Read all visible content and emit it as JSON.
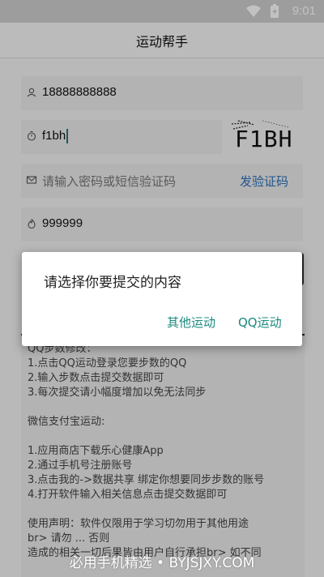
{
  "status_bar": {
    "time": "9:01",
    "icons": [
      "wifi-icon",
      "battery-charging-icon"
    ]
  },
  "app_bar": {
    "title": "运动帮手"
  },
  "form": {
    "phone": {
      "value": "18888888888",
      "icon": "user-icon"
    },
    "captcha": {
      "value": "f1bh",
      "image_text": "F1BH",
      "icon": "timer-icon"
    },
    "password": {
      "placeholder": "请输入密码或短信验证码",
      "icon": "mail-icon",
      "sms_link": "发验证码"
    },
    "steps": {
      "value": "999999",
      "icon": "flame-icon"
    }
  },
  "info": {
    "lines": [
      "QQ步数修改：",
      "1.点击QQ运动登录您要步数的QQ",
      "2.输入步数点击提交数据即可",
      "3.每次提交请小幅度增加以免无法同步",
      "",
      "微信支付宝运动:",
      "",
      "1.应用商店下载乐心健康App",
      "2.通过手机号注册账号",
      "3.点击我的->数据共享 绑定你想要同步步数的账号",
      "4.打开软件输入相关信息点击提交数据即可",
      "",
      "使用声明：软件仅限用于学习切勿用于其他用途",
      "br> 请勿 ... 否则",
      "造成的相关一切后果皆由用户自行承担br> 如不同"
    ]
  },
  "dialog": {
    "title": "请选择你要提交的内容",
    "buttons": {
      "other": "其他运动",
      "qq": "QQ运动"
    }
  },
  "watermark": "必用手机精选 • BYJSJXY.COM",
  "colors": {
    "accent": "#1a8a7e",
    "link": "#2d72b8",
    "scrim": "rgba(0,0,0,0.24)"
  }
}
